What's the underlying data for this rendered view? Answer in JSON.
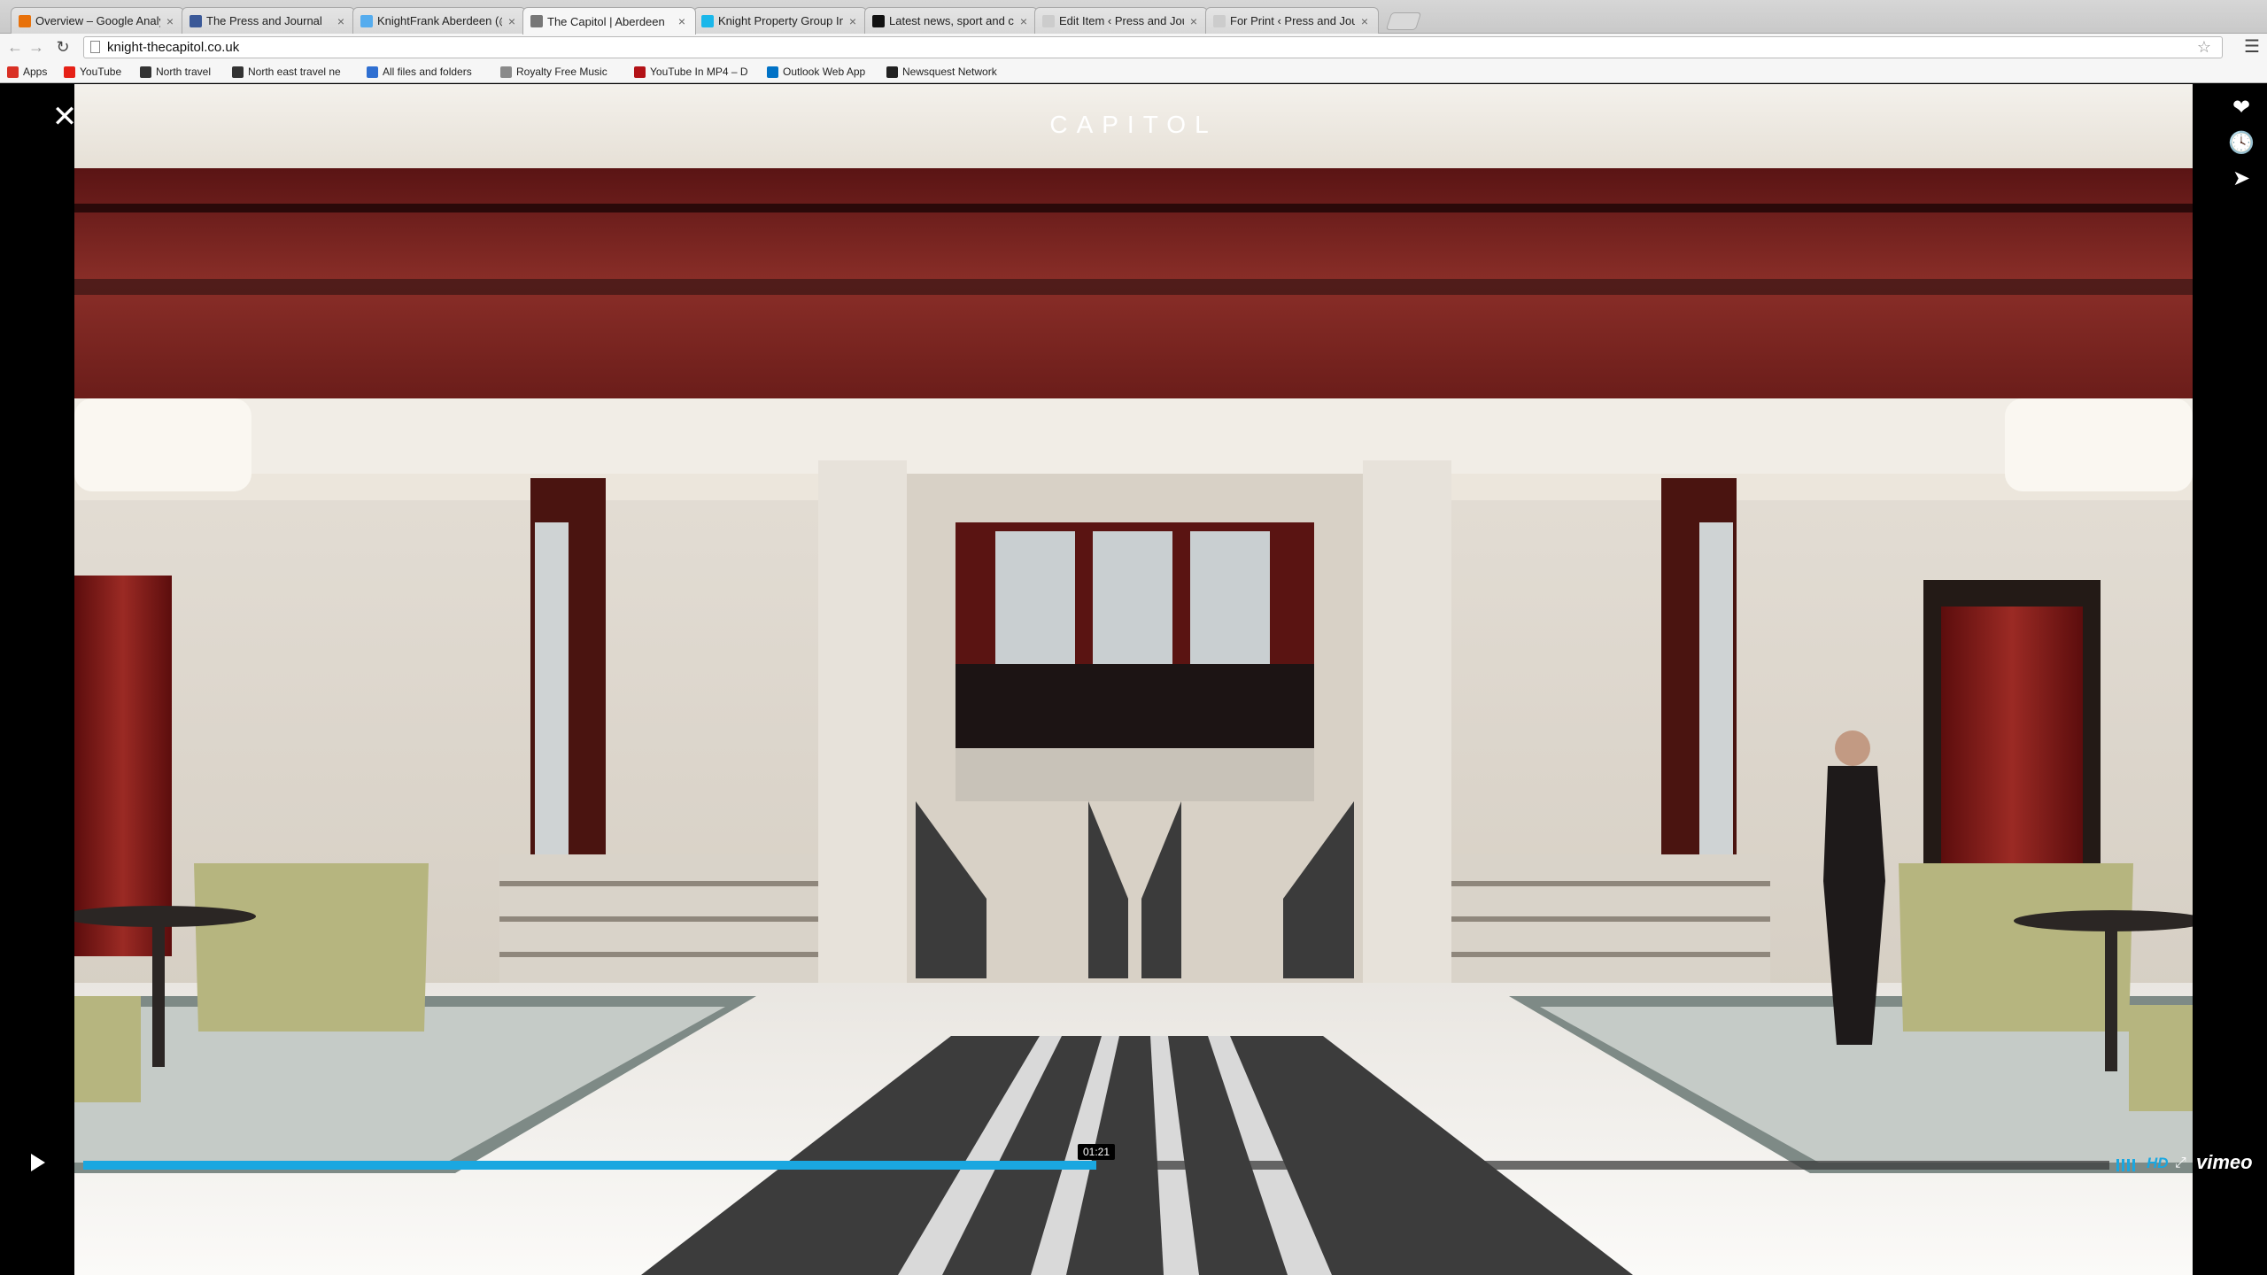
{
  "browser": {
    "tabs": [
      {
        "title": "Overview – Google Analyti",
        "favicon_color": "#e8710a",
        "active": false
      },
      {
        "title": "The Press and Journal",
        "favicon_color": "#3b5998",
        "active": false
      },
      {
        "title": "KnightFrank Aberdeen (@",
        "favicon_color": "#55acee",
        "active": false
      },
      {
        "title": "The Capitol | Aberdeen",
        "favicon_color": "#777777",
        "active": true
      },
      {
        "title": "Knight Property Group Inte",
        "favicon_color": "#1ab7ea",
        "active": false
      },
      {
        "title": "Latest news, sport and co",
        "favicon_color": "#111111",
        "active": false
      },
      {
        "title": "Edit Item ‹ Press and Journ",
        "favicon_color": "#cccccc",
        "active": false
      },
      {
        "title": "For Print ‹ Press and Journ",
        "favicon_color": "#cccccc",
        "active": false
      }
    ],
    "url": "knight-thecapitol.co.uk",
    "bookmarks": [
      {
        "label": "Apps",
        "icon_color": "#d93025"
      },
      {
        "label": "YouTube",
        "icon_color": "#e62117"
      },
      {
        "label": "North travel",
        "icon_color": "#333333"
      },
      {
        "label": "North east travel ne",
        "icon_color": "#333333"
      },
      {
        "label": "All files and folders",
        "icon_color": "#2f6fd1"
      },
      {
        "label": "Royalty Free Music",
        "icon_color": "#8a8a8a"
      },
      {
        "label": "YouTube In MP4 – D",
        "icon_color": "#b31217"
      },
      {
        "label": "Outlook Web App",
        "icon_color": "#0072c6"
      },
      {
        "label": "Newsquest Network",
        "icon_color": "#222222"
      }
    ]
  },
  "lightbox": {
    "close_glyph": "✕",
    "actions": [
      {
        "name": "like-button",
        "icon": "heart-icon",
        "glyph": "❤"
      },
      {
        "name": "watch-later-button",
        "icon": "clock-icon",
        "glyph": "🕓"
      },
      {
        "name": "share-button",
        "icon": "paper-plane-icon",
        "glyph": "➤"
      }
    ]
  },
  "video": {
    "title": "CAPITOL",
    "time": "01:21",
    "progress": 0.5,
    "hd_label": "HD",
    "brand": "vimeo",
    "accent_color": "#1aa7e0"
  }
}
